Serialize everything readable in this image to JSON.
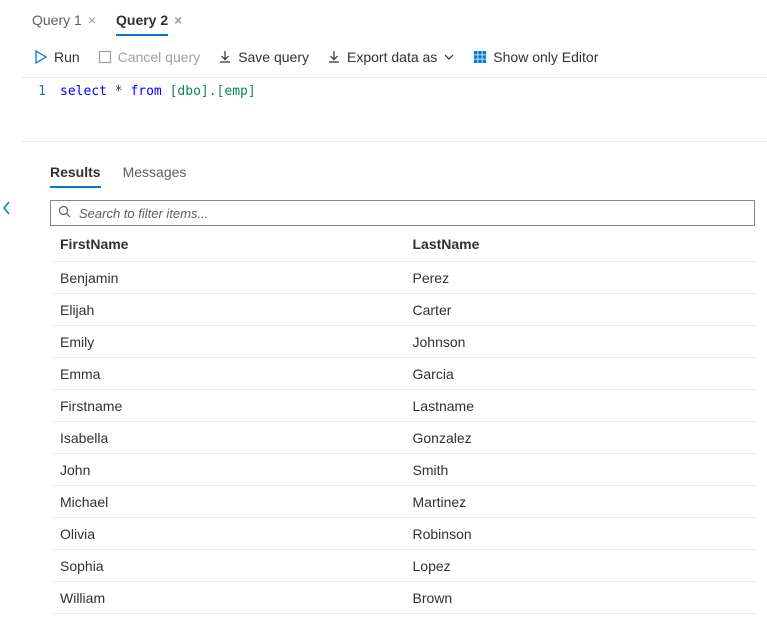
{
  "tabs": [
    {
      "label": "Query 1",
      "active": false
    },
    {
      "label": "Query 2",
      "active": true
    }
  ],
  "toolbar": {
    "run": "Run",
    "cancel": "Cancel query",
    "save": "Save query",
    "export": "Export data as",
    "showEditor": "Show only Editor"
  },
  "editor": {
    "lineNumber": "1",
    "sqlKeywordSelect": "select",
    "sqlStar": " * ",
    "sqlKeywordFrom": "from",
    "sqlSpace": " ",
    "sqlIdent": "[dbo].[emp]"
  },
  "resultsTabs": {
    "results": "Results",
    "messages": "Messages"
  },
  "search": {
    "placeholder": "Search to filter items..."
  },
  "columns": [
    "FirstName",
    "LastName"
  ],
  "rows": [
    {
      "FirstName": "Benjamin",
      "LastName": "Perez"
    },
    {
      "FirstName": "Elijah",
      "LastName": "Carter"
    },
    {
      "FirstName": "Emily",
      "LastName": "Johnson"
    },
    {
      "FirstName": "Emma",
      "LastName": "Garcia"
    },
    {
      "FirstName": "Firstname",
      "LastName": "Lastname"
    },
    {
      "FirstName": "Isabella",
      "LastName": "Gonzalez"
    },
    {
      "FirstName": "John",
      "LastName": "Smith"
    },
    {
      "FirstName": "Michael",
      "LastName": "Martinez"
    },
    {
      "FirstName": "Olivia",
      "LastName": "Robinson"
    },
    {
      "FirstName": "Sophia",
      "LastName": "Lopez"
    },
    {
      "FirstName": "William",
      "LastName": "Brown"
    }
  ]
}
